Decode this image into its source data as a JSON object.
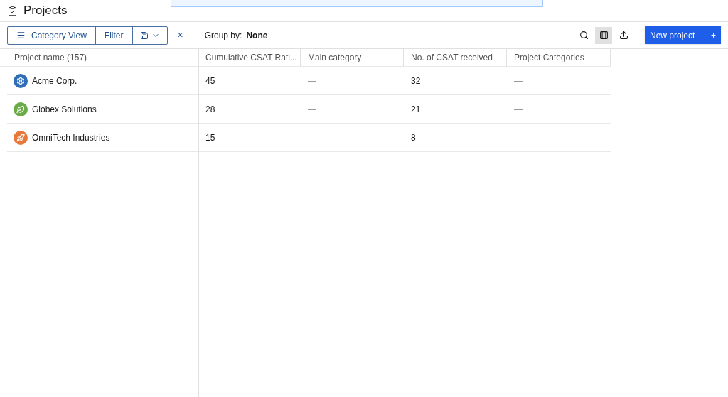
{
  "page": {
    "title": "Projects"
  },
  "toolbar": {
    "view_button": "Category View",
    "filter_button": "Filter",
    "group_by_label": "Group by:",
    "group_by_value": "None",
    "clear": "×",
    "columns_toggle": {
      "selected": true
    },
    "new_button": "New project",
    "new_button_icon": "+"
  },
  "table": {
    "columns": [
      "Project name (157)",
      "Cumulative CSAT Rati...",
      "Main category",
      "No. of CSAT received",
      "Project Categories"
    ],
    "rows": [
      {
        "kind": "gear",
        "color": "#2f6db5",
        "name": "Acme Corp.",
        "csat": "45",
        "main_category": "—",
        "count": "32",
        "categories": "—"
      },
      {
        "kind": "leaf",
        "color": "#6aab48",
        "name": "Globex Solutions",
        "csat": "28",
        "main_category": "—",
        "count": "21",
        "categories": "—"
      },
      {
        "kind": "rocket",
        "color": "#e8773a",
        "name": "OmniTech Industries",
        "csat": "15",
        "main_category": "—",
        "count": "8",
        "categories": "—"
      }
    ]
  }
}
